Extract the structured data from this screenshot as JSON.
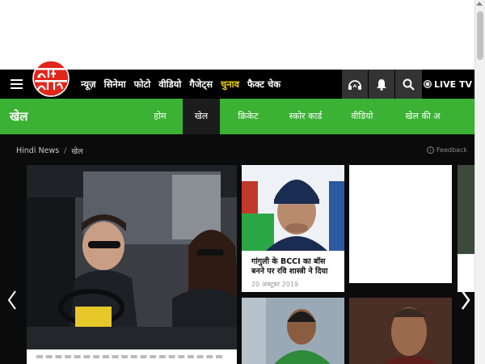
{
  "nav": {
    "logo_text": "आज तक",
    "items": [
      "न्यूज़",
      "सिनेमा",
      "फोटो",
      "वीडियो",
      "गैजेट्स",
      "चुनाव",
      "फैक्ट चेक"
    ],
    "highlight_index": 5,
    "live_tv_label": "LIVE TV"
  },
  "section": {
    "title": "खेल",
    "tabs": [
      "होम",
      "खेल",
      "क्रिकेट",
      "स्कोर कार्ड",
      "वीडियो",
      "खेल की अ"
    ],
    "active_tab": 1
  },
  "breadcrumb": {
    "home": "Hindi News",
    "current": "खेल"
  },
  "feedback_label": "Feedback",
  "cards": [
    {
      "title": "गांगुली के BCCI का बॉस बनने पर रवि शास्त्री ने दिया",
      "date": "20 अक्टूबर 2019"
    }
  ],
  "colors": {
    "nav_bg": "#000000",
    "section_bg": "#3bb234",
    "highlight": "#f2d400",
    "logo_red": "#e1261c"
  }
}
